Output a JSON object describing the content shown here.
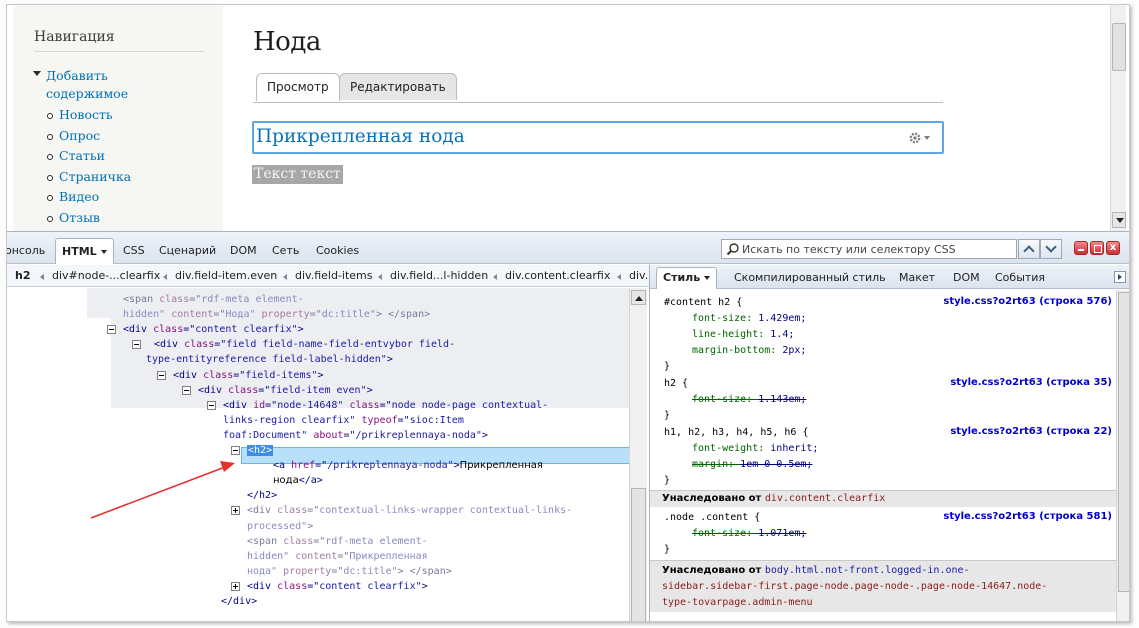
{
  "site": {
    "sidebar": {
      "title": "Навигация",
      "items": [
        {
          "label": "Добавить содержимое",
          "level": "parent"
        },
        {
          "label": "Новость",
          "level": "child"
        },
        {
          "label": "Опрос",
          "level": "child"
        },
        {
          "label": "Статьи",
          "level": "child"
        },
        {
          "label": "Страничка",
          "level": "child"
        },
        {
          "label": "Видео",
          "level": "child"
        },
        {
          "label": "Отзыв",
          "level": "child"
        }
      ]
    },
    "page_title": "Нода",
    "tabs": [
      {
        "label": "Просмотр",
        "active": true
      },
      {
        "label": "Редактировать",
        "active": false
      }
    ],
    "attached_node_title": "Прикрепленная нода",
    "body_text": "Текст текст"
  },
  "firebug": {
    "tabs": [
      "онсоль",
      "HTML",
      "CSS",
      "Сценарий",
      "DOM",
      "Сеть",
      "Cookies"
    ],
    "active_tab": "HTML",
    "search_placeholder": "Искать по тексту или селектору CSS",
    "close_label": "x",
    "breadcrumbs": [
      "h2",
      "div#node-...clearfix",
      "div.field-item.even",
      "div.field-items",
      "div.field...l-hidden",
      "div.content.clearfix",
      "div."
    ],
    "html_lines": [
      {
        "indent": 0,
        "parts": [
          [
            "t",
            "<span "
          ],
          [
            "a",
            "class"
          ],
          [
            "t",
            "=\""
          ],
          [
            "v",
            "rdf-meta element-"
          ]
        ],
        "gray": true
      },
      {
        "indent": 0,
        "parts": [
          [
            "v",
            "hidden\""
          ],
          [
            "t",
            " "
          ],
          [
            "a",
            "content"
          ],
          [
            "t",
            "=\""
          ],
          [
            "v",
            "Нода\""
          ],
          [
            "t",
            " "
          ],
          [
            "a",
            "property"
          ],
          [
            "t",
            "=\""
          ],
          [
            "v",
            "dc:title\""
          ],
          [
            "t",
            "> </span>"
          ]
        ],
        "gray": true
      },
      {
        "indent": 1,
        "parts": [
          [
            "t",
            "<div "
          ],
          [
            "a",
            "class"
          ],
          [
            "t",
            "=\""
          ],
          [
            "v",
            "content clearfix\""
          ],
          [
            "t",
            ">"
          ]
        ]
      },
      {
        "indent": 2,
        "parts": [
          [
            "t",
            "<div "
          ],
          [
            "a",
            "class"
          ],
          [
            "t",
            "=\""
          ],
          [
            "v",
            "field field-name-field-entvybor field-"
          ]
        ]
      },
      {
        "indent": 2,
        "parts": [
          [
            "v",
            "type-entityreference field-label-hidden\""
          ],
          [
            "t",
            ">"
          ]
        ]
      },
      {
        "indent": 3,
        "parts": [
          [
            "t",
            "<div "
          ],
          [
            "a",
            "class"
          ],
          [
            "t",
            "=\""
          ],
          [
            "v",
            "field-items\""
          ],
          [
            "t",
            ">"
          ]
        ]
      },
      {
        "indent": 4,
        "parts": [
          [
            "t",
            "<div "
          ],
          [
            "a",
            "class"
          ],
          [
            "t",
            "=\""
          ],
          [
            "v",
            "field-item even\""
          ],
          [
            "t",
            ">"
          ]
        ]
      },
      {
        "indent": 5,
        "parts": [
          [
            "t",
            "<div "
          ],
          [
            "a",
            "id"
          ],
          [
            "t",
            "=\""
          ],
          [
            "v",
            "node-14648\""
          ],
          [
            "t",
            " "
          ],
          [
            "a",
            "class"
          ],
          [
            "t",
            "=\""
          ],
          [
            "v",
            "node node-page contextual-"
          ]
        ]
      },
      {
        "indent": 5,
        "parts": [
          [
            "v",
            "links-region clearfix\""
          ],
          [
            "t",
            " "
          ],
          [
            "a",
            "typeof"
          ],
          [
            "t",
            "=\""
          ],
          [
            "v",
            "sioc:Item"
          ]
        ]
      },
      {
        "indent": 5,
        "parts": [
          [
            "v",
            "foaf:Document\""
          ],
          [
            "t",
            " "
          ],
          [
            "a",
            "about"
          ],
          [
            "t",
            "=\""
          ],
          [
            "v",
            "/prikreplennaya-noda\""
          ],
          [
            "t",
            ">"
          ]
        ]
      },
      {
        "indent": 6,
        "parts": [
          [
            "t",
            "<h2>"
          ]
        ],
        "selected": true
      },
      {
        "indent": 7,
        "parts": [
          [
            "t",
            "<a "
          ],
          [
            "a",
            "href"
          ],
          [
            "t",
            "=\""
          ],
          [
            "v",
            "/prikreplennaya-noda\""
          ],
          [
            "t",
            ">"
          ],
          [
            "x",
            "Прикрепленная"
          ]
        ]
      },
      {
        "indent": 7,
        "parts": [
          [
            "x",
            "нода"
          ],
          [
            "t",
            "</a>"
          ]
        ]
      },
      {
        "indent": 6,
        "parts": [
          [
            "t",
            "</h2>"
          ]
        ]
      },
      {
        "indent": 6,
        "parts": [
          [
            "t",
            "<div "
          ],
          [
            "a",
            "class"
          ],
          [
            "t",
            "=\""
          ],
          [
            "v",
            "contextual-links-wrapper contextual-links-"
          ]
        ],
        "gray": true
      },
      {
        "indent": 6,
        "parts": [
          [
            "v",
            "processed\""
          ],
          [
            "t",
            ">"
          ]
        ],
        "gray": true
      },
      {
        "indent": 6,
        "parts": [
          [
            "t",
            "<span "
          ],
          [
            "a",
            "class"
          ],
          [
            "t",
            "=\""
          ],
          [
            "v",
            "rdf-meta element-"
          ]
        ],
        "gray": true
      },
      {
        "indent": 6,
        "parts": [
          [
            "v",
            "hidden\""
          ],
          [
            "t",
            " "
          ],
          [
            "a",
            "content"
          ],
          [
            "t",
            "=\""
          ],
          [
            "v",
            "Прикрепленная"
          ]
        ],
        "gray": true
      },
      {
        "indent": 6,
        "parts": [
          [
            "v",
            "нода\""
          ],
          [
            "t",
            " "
          ],
          [
            "a",
            "property"
          ],
          [
            "t",
            "=\""
          ],
          [
            "v",
            "dc:title\""
          ],
          [
            "t",
            "> </span>"
          ]
        ],
        "gray": true
      },
      {
        "indent": 6,
        "parts": [
          [
            "t",
            "<div "
          ],
          [
            "a",
            "class"
          ],
          [
            "t",
            "=\""
          ],
          [
            "v",
            "content clearfix\""
          ],
          [
            "t",
            ">"
          ]
        ]
      },
      {
        "indent": 5,
        "parts": [
          [
            "t",
            "</div>"
          ]
        ]
      }
    ],
    "side_tabs": [
      "Стиль",
      "Скомпилированный стиль",
      "Макет",
      "DOM",
      "События"
    ],
    "style_rules": [
      {
        "selector": "#content h2 {",
        "source": "style.css?o2rt63 (строка 576)",
        "decls": [
          {
            "prop": "font-size",
            "value": "1.429em;",
            "struck": false
          },
          {
            "prop": "line-height",
            "value": "1.4;",
            "struck": false
          },
          {
            "prop": "margin-bottom",
            "value": "2px;",
            "struck": false
          }
        ]
      },
      {
        "selector": "h2 {",
        "source": "style.css?o2rt63 (строка 35)",
        "decls": [
          {
            "prop": "font-size",
            "value": "1.143em;",
            "struck": true
          }
        ]
      },
      {
        "selector": "h1, h2, h3, h4, h5, h6 {",
        "source": "style.css?o2rt63 (строка 22)",
        "decls": [
          {
            "prop": "font-weight",
            "value": "inherit;",
            "struck": false
          },
          {
            "prop": "margin",
            "value": "1em 0 0.5em;",
            "struck": true
          }
        ]
      }
    ],
    "inherited_1": {
      "label": "Унаследовано от",
      "from": "div.content.clearfix"
    },
    "inherited_rule": {
      "selector": ".node .content {",
      "source": "style.css?o2rt63 (строка 581)",
      "prop": "font-size",
      "value": "1.071em;"
    },
    "inherited_2": {
      "label": "Унаследовано от",
      "from_1": "body.html.not-front.logged-in.one-",
      "from_2": "sidebar.sidebar-first.page-node.page-node-.page-node-14647.node-",
      "from_3": "type-tovarpage.admin-menu"
    }
  }
}
